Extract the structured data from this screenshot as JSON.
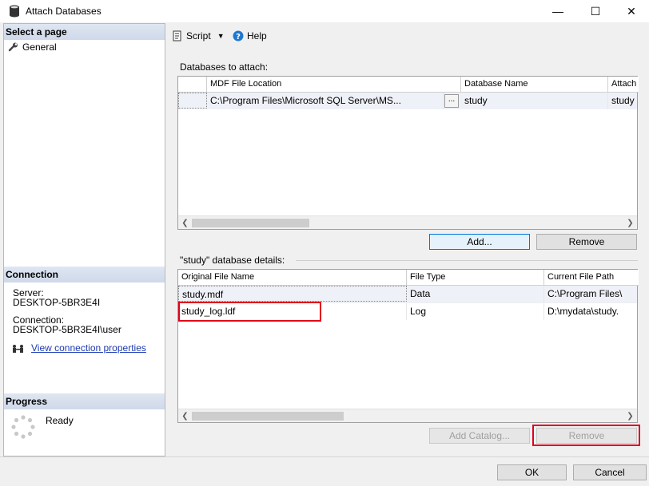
{
  "window": {
    "title": "Attach Databases",
    "controls": {
      "minimize": "—",
      "maximize": "☐",
      "close": "✕"
    }
  },
  "left": {
    "select_page_header": "Select a page",
    "pages": [
      {
        "label": "General",
        "icon": "wrench-icon"
      }
    ],
    "connection_header": "Connection",
    "server_label": "Server:",
    "server_value": "DESKTOP-5BR3E4I",
    "connection_label": "Connection:",
    "connection_value": "DESKTOP-5BR3E4I\\user",
    "view_connection_link": "View connection properties",
    "progress_header": "Progress",
    "progress_status": "Ready"
  },
  "toolbar": {
    "script_label": "Script",
    "help_label": "Help"
  },
  "attach": {
    "label": "Databases to attach:",
    "columns": [
      "MDF File Location",
      "Database Name",
      "Attach"
    ],
    "rows": [
      {
        "mdf": "C:\\Program Files\\Microsoft SQL Server\\MS...",
        "browse": "...",
        "db_name": "study",
        "attach_as": "study"
      }
    ],
    "add_button": "Add...",
    "remove_button": "Remove"
  },
  "details": {
    "label": "\"study\" database details:",
    "columns": [
      "Original File Name",
      "File Type",
      "Current File Path"
    ],
    "rows": [
      {
        "name": "study.mdf",
        "type": "Data",
        "path": "C:\\Program Files\\"
      },
      {
        "name": "study_log.ldf",
        "type": "Log",
        "path": "D:\\mydata\\study."
      }
    ],
    "add_catalog_button": "Add Catalog...",
    "remove_button": "Remove"
  },
  "footer": {
    "ok_button": "OK",
    "cancel_button": "Cancel"
  },
  "colors": {
    "highlight": "#e0001a",
    "link": "#1d3bb2",
    "header_band": "#d6deec"
  }
}
